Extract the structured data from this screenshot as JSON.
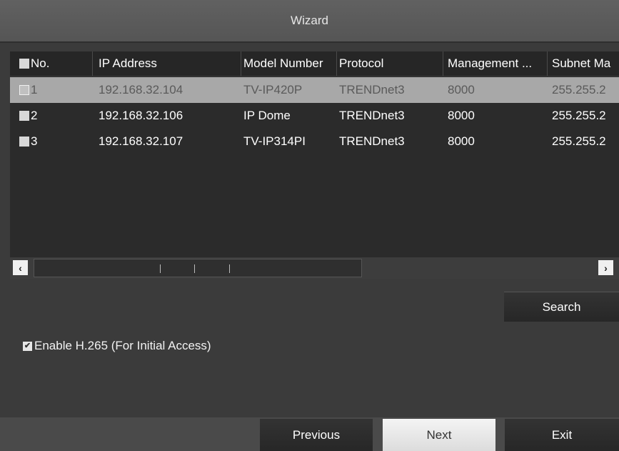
{
  "window": {
    "title": "Wizard"
  },
  "table": {
    "columns": [
      "No.",
      "IP Address",
      "Model Number",
      "Protocol",
      "Management ...",
      "Subnet Ma"
    ],
    "rows": [
      {
        "no": "1",
        "ip": "192.168.32.104",
        "model": "TV-IP420P",
        "protocol": "TRENDnet3",
        "port": "8000",
        "subnet": "255.255.2",
        "selected": true
      },
      {
        "no": "2",
        "ip": "192.168.32.106",
        "model": "IP Dome",
        "protocol": "TRENDnet3",
        "port": "8000",
        "subnet": "255.255.2",
        "selected": false
      },
      {
        "no": "3",
        "ip": "192.168.32.107",
        "model": "TV-IP314PI",
        "protocol": "TRENDnet3",
        "port": "8000",
        "subnet": "255.255.2",
        "selected": false
      }
    ]
  },
  "scrollbar": {
    "left_glyph": "‹",
    "right_glyph": "›"
  },
  "buttons": {
    "search": "Search",
    "previous": "Previous",
    "next": "Next",
    "exit": "Exit"
  },
  "options": {
    "h265_label": "Enable H.265 (For Initial Access)",
    "h265_checked": true
  },
  "icons": {
    "checkbox_checked": "checkmark-icon",
    "scroll_left": "chevron-left-icon",
    "scroll_right": "chevron-right-icon"
  },
  "colors": {
    "background": "#3b3b3b",
    "title_bar": "#5c5c5c",
    "selected_row": "#a8a8a8",
    "next_button": "#e8e8e8"
  }
}
